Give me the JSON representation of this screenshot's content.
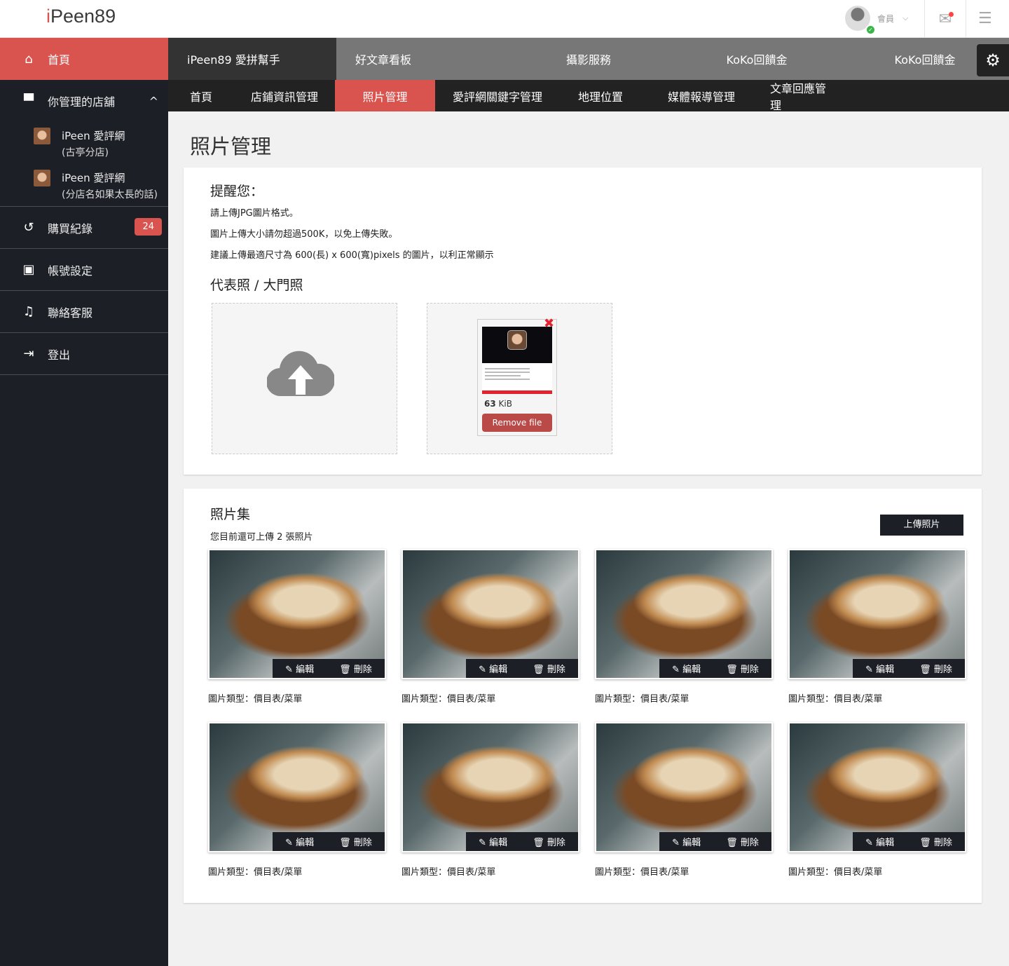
{
  "brand": {
    "logo": "iPeen89"
  },
  "header": {
    "user_label": "會員",
    "icons": [
      "avatar",
      "mail-icon",
      "list-icon"
    ]
  },
  "sidebar": {
    "home": "首頁",
    "stores_label": "你管理的店舖",
    "stores": [
      {
        "name": "iPeen 愛評網",
        "branch": "(古亭分店)"
      },
      {
        "name": "iPeen 愛評網",
        "branch": "(分店名如果太長的話)"
      }
    ],
    "items": [
      {
        "label": "購買紀錄",
        "badge": "24"
      },
      {
        "label": "帳號設定"
      },
      {
        "label": "聯絡客服"
      },
      {
        "label": "登出"
      }
    ]
  },
  "nav_primary": [
    "iPeen89 愛拼幫手",
    "好文章看板",
    "攝影服務",
    "KoKo回饋金",
    "KoKo回饋金"
  ],
  "nav_secondary": [
    "首頁",
    "店鋪資訊管理",
    "照片管理",
    "愛評網關鍵字管理",
    "地理位置",
    "媒體報導管理",
    "文章回應管理"
  ],
  "nav_secondary_active": 2,
  "page_title": "照片管理",
  "reminder": {
    "title": "提醒您：",
    "lines": [
      "請上傳JPG圖片格式。",
      "圖片上傳大小請勿超過500K，以免上傳失敗。",
      "建議上傳最適尺寸為 600(長) x 600(寬)pixels 的圖片，以利正常顯示"
    ]
  },
  "cover": {
    "title": "代表照 / 大門照",
    "file_size_num": "63",
    "file_size_unit": "KiB",
    "remove_label": "Remove file"
  },
  "gallery": {
    "title": "照片集",
    "subtitle": "您目前還可上傳 2 張照片",
    "upload_label": "上傳照片",
    "edit_label": "編輯",
    "delete_label": "刪除",
    "photos": [
      {
        "caption": "圖片類型：價目表/菜單"
      },
      {
        "caption": "圖片類型：價目表/菜單"
      },
      {
        "caption": "圖片類型：價目表/菜單"
      },
      {
        "caption": "圖片類型：價目表/菜單"
      },
      {
        "caption": "圖片類型：價目表/菜單"
      },
      {
        "caption": "圖片類型：價目表/菜單"
      },
      {
        "caption": "圖片類型：價目表/菜單"
      },
      {
        "caption": "圖片類型：價目表/菜單"
      }
    ]
  },
  "colors": {
    "accent": "#d9534f",
    "sidebar": "#1c1f26",
    "nav": "#777777"
  }
}
